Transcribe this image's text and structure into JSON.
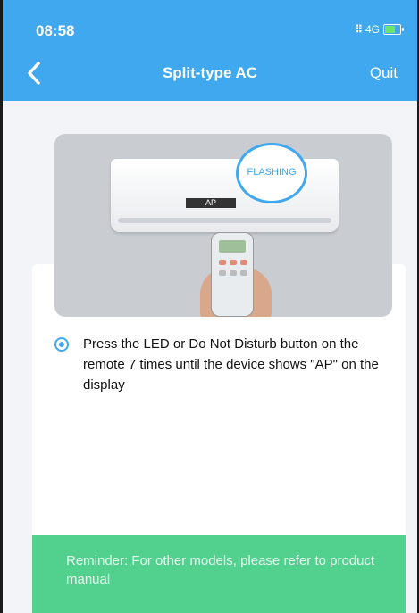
{
  "status_bar": {
    "time": "08:58",
    "network": "4G"
  },
  "nav": {
    "title": "Split-type AC",
    "quit_label": "Quit"
  },
  "illustration": {
    "bubble_text": "FLASHING",
    "display_text": "AP"
  },
  "instruction": {
    "text": "Press the LED or Do Not Disturb button on the remote 7 times until the device shows \"AP\" on the display"
  },
  "reminder": {
    "text": "Reminder: For other models, please refer to product manual"
  },
  "colors": {
    "header": "#3fa8ef",
    "accent": "#3fa8ef",
    "reminder": "#52d08e"
  }
}
